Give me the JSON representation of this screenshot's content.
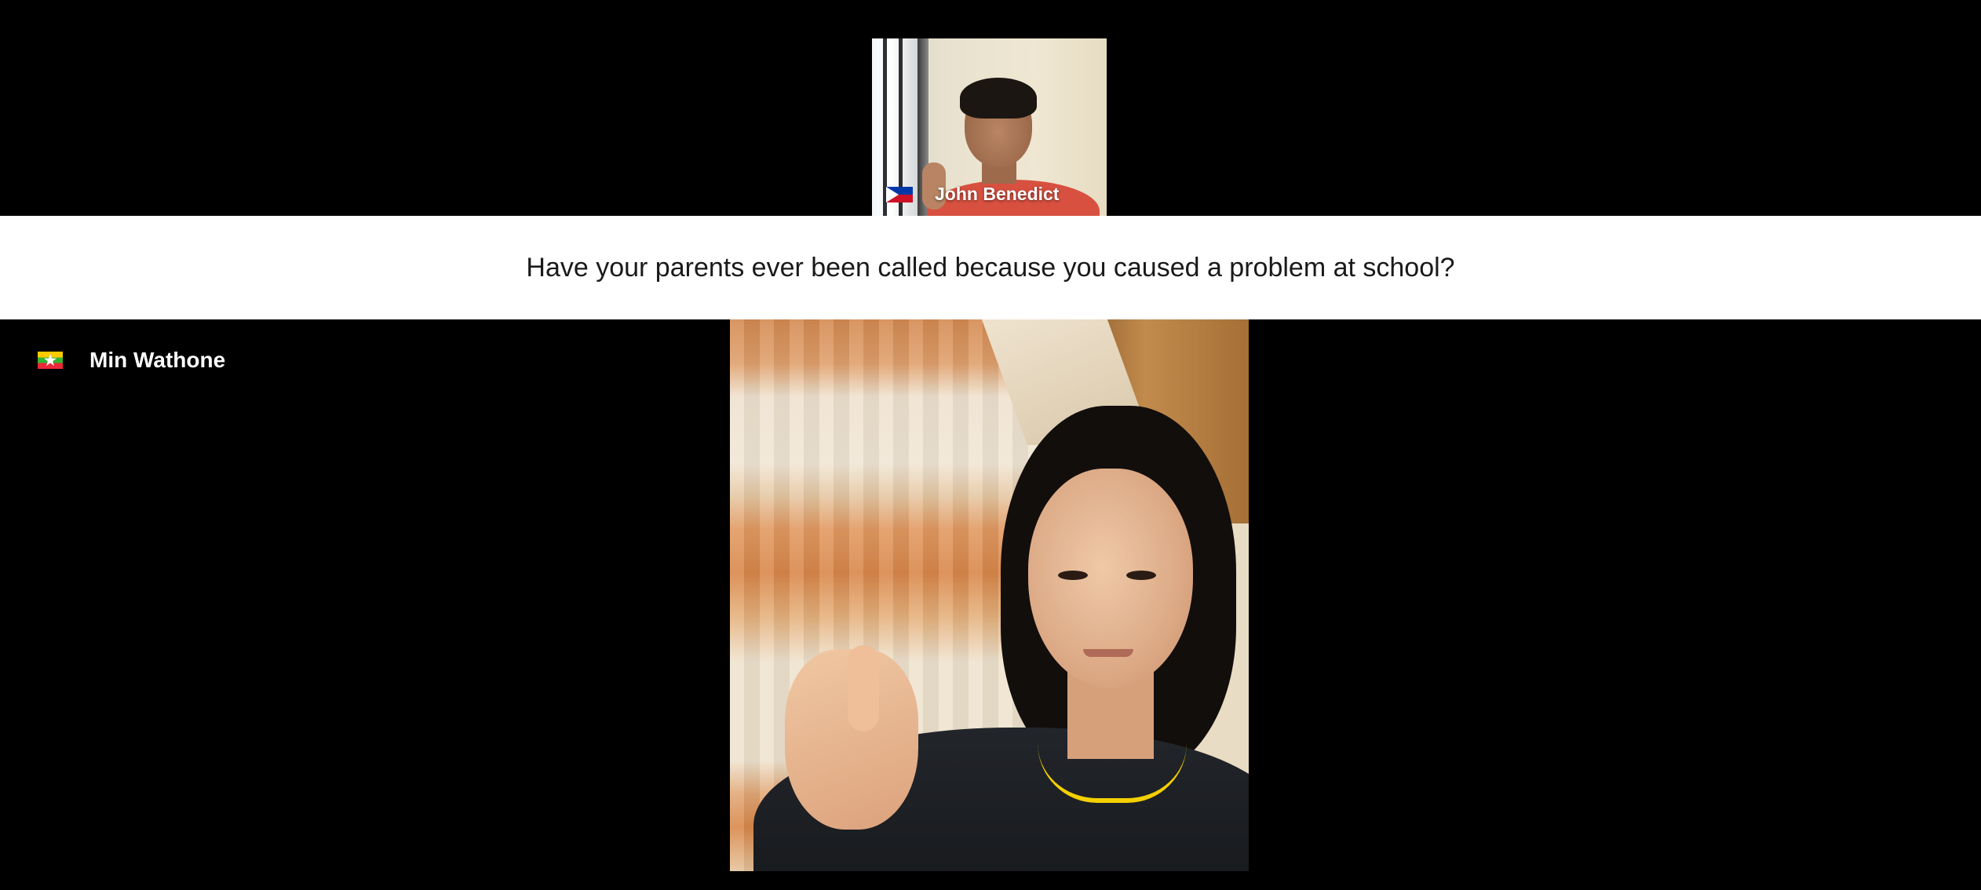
{
  "call": {
    "remote_participant": {
      "name": "John Benedict",
      "flag_icon": "philippines-flag-icon"
    },
    "prompt": {
      "text": "Have your parents ever been called because you caused a problem at school?"
    },
    "local_participant": {
      "name": "Min Wathone",
      "flag_icon": "myanmar-flag-icon"
    }
  },
  "colors": {
    "background": "#000000",
    "banner": "#ffffff",
    "banner_text": "#1a1a1a",
    "name_text": "#ffffff"
  }
}
